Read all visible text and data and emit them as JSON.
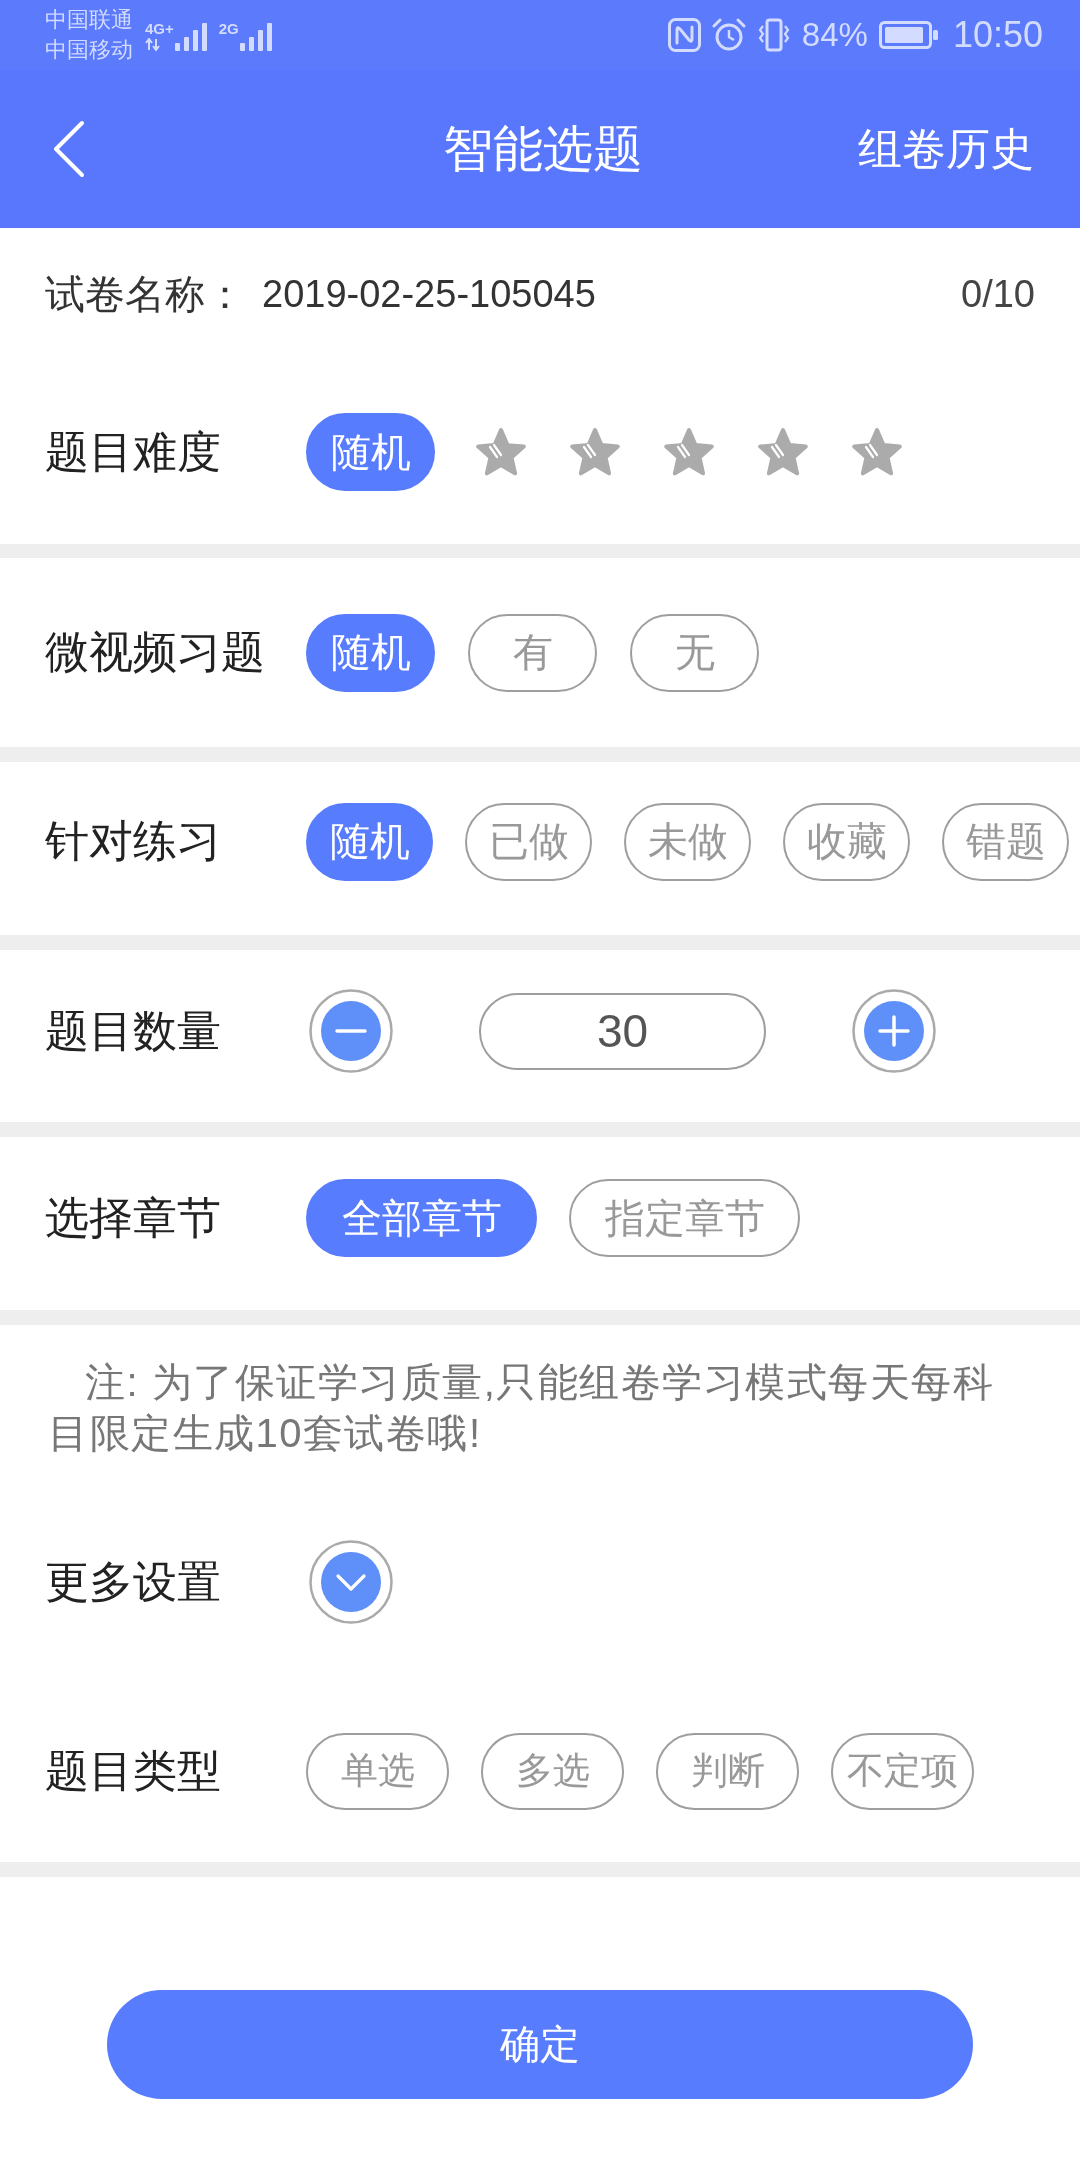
{
  "status_bar": {
    "carriers": [
      "中国联通",
      "中国移动"
    ],
    "networks": [
      "4G+",
      "2G"
    ],
    "battery": "84%",
    "time": "10:50"
  },
  "header": {
    "title": "智能选题",
    "action": "组卷历史"
  },
  "paper_name": {
    "label": "试卷名称：",
    "value": "2019-02-25-105045",
    "counter": "0/10"
  },
  "difficulty": {
    "label": "题目难度",
    "options": [
      {
        "kind": "text",
        "label": "随机",
        "selected": true
      },
      {
        "kind": "star",
        "selected": false
      },
      {
        "kind": "star",
        "selected": false
      },
      {
        "kind": "star",
        "selected": false
      },
      {
        "kind": "star",
        "selected": false
      },
      {
        "kind": "star",
        "selected": false
      }
    ]
  },
  "video_questions": {
    "label": "微视频习题",
    "options": [
      {
        "label": "随机",
        "selected": true
      },
      {
        "label": "有",
        "selected": false
      },
      {
        "label": "无",
        "selected": false
      }
    ]
  },
  "practice": {
    "label": "针对练习",
    "options": [
      {
        "label": "随机",
        "selected": true
      },
      {
        "label": "已做",
        "selected": false
      },
      {
        "label": "未做",
        "selected": false
      },
      {
        "label": "收藏",
        "selected": false
      },
      {
        "label": "错题",
        "selected": false
      }
    ]
  },
  "question_count": {
    "label": "题目数量",
    "value": "30"
  },
  "chapters": {
    "label": "选择章节",
    "options": [
      {
        "label": "全部章节",
        "selected": true
      },
      {
        "label": "指定章节",
        "selected": false
      }
    ]
  },
  "note": "注: 为了保证学习质量,只能组卷学习模式每天每科目限定生成10套试卷哦!",
  "more_settings": {
    "label": "更多设置",
    "expanded": false
  },
  "question_types": {
    "label": "题目类型",
    "options": [
      {
        "label": "单选",
        "selected": false
      },
      {
        "label": "多选",
        "selected": false
      },
      {
        "label": "判断",
        "selected": false
      },
      {
        "label": "不定项",
        "selected": false
      }
    ]
  },
  "confirm_button": "确定"
}
